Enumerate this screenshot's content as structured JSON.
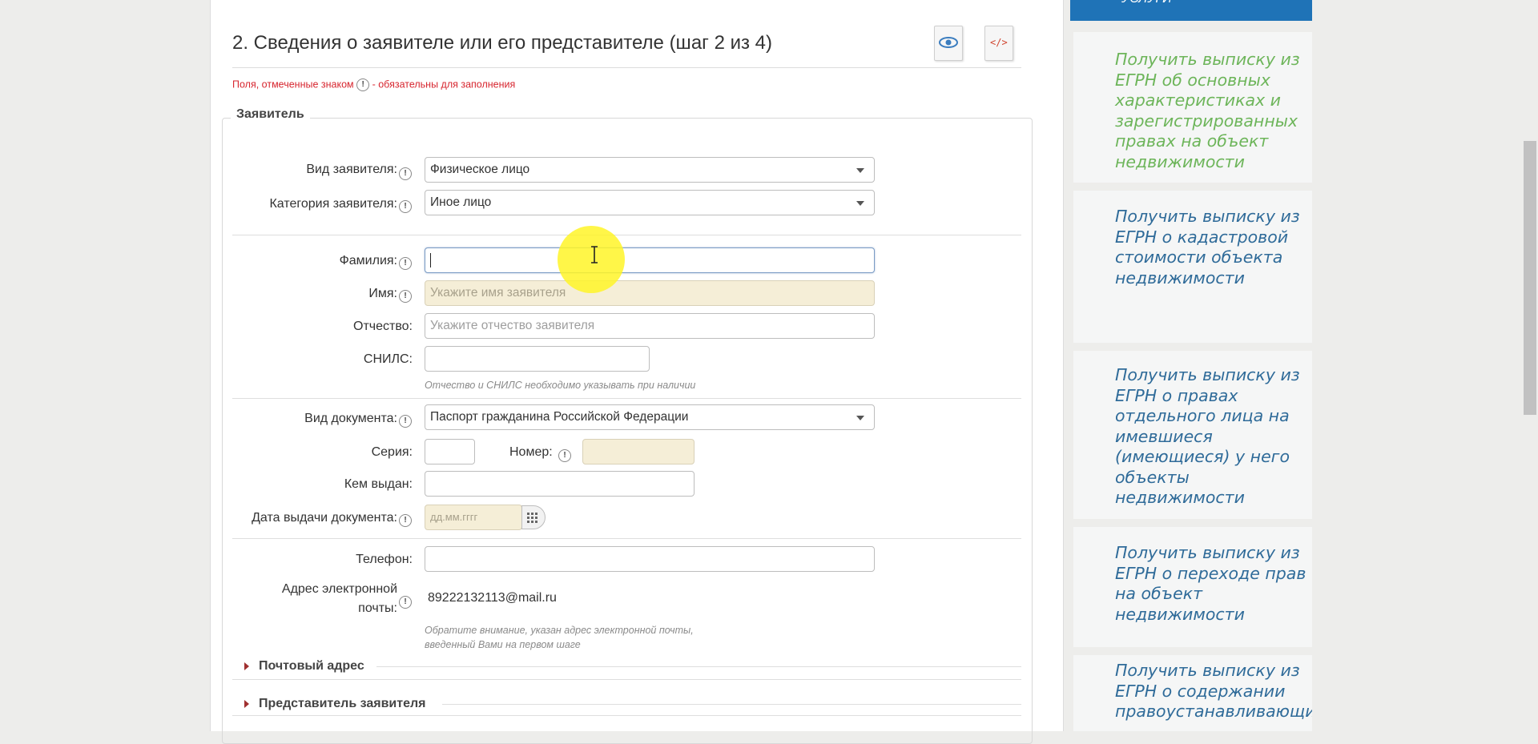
{
  "form": {
    "title": "2. Сведения о заявителе или его представителе (шаг 2 из 4)",
    "required_note_before": "Поля, отмеченные знаком",
    "required_note_after": "- обязательны для заполнения",
    "required_mark": "!",
    "fieldset_legend": "Заявитель",
    "applicant_type": {
      "label": "Вид заявителя:",
      "value": "Физическое лицо"
    },
    "applicant_category": {
      "label": "Категория заявителя:",
      "value": "Иное лицо"
    },
    "surname": {
      "label": "Фамилия:",
      "value": ""
    },
    "first_name": {
      "label": "Имя:",
      "placeholder": "Укажите имя заявителя"
    },
    "patronymic": {
      "label": "Отчество:",
      "placeholder": "Укажите отчество заявителя"
    },
    "snils": {
      "label": "СНИЛС:",
      "value": ""
    },
    "snils_hint": "Отчество и СНИЛС необходимо указывать при наличии",
    "doc_type": {
      "label": "Вид документа:",
      "value": "Паспорт гражданина Российской Федерации"
    },
    "series": {
      "label": "Серия:",
      "value": ""
    },
    "number": {
      "label": "Номер:",
      "value": ""
    },
    "issued_by": {
      "label": "Кем выдан:",
      "value": ""
    },
    "issue_date": {
      "label": "Дата выдачи документа:",
      "placeholder": "дд.мм.гггг"
    },
    "phone": {
      "label": "Телефон:",
      "value": ""
    },
    "email": {
      "label_line1": "Адрес электронной",
      "label_line2": "почты:",
      "value": "89222132113@mail.ru"
    },
    "email_hint_line1": "Обратите внимание, указан адрес электронной почты,",
    "email_hint_line2": "введенный Вами на первом шаге",
    "postal_section": "Почтовый адрес",
    "representative_section": "Представитель заявителя"
  },
  "sidebar": {
    "top_button": "УСЛУГИ",
    "links": [
      {
        "text": "Получить выписку из ЕГРН об основных характеристиках и зарегистрированных правах на объект недвижимости",
        "color": "#6db55a"
      },
      {
        "text": "Получить выписку из ЕГРН о кадастровой стоимости объекта недвижимости",
        "color": "#2f6b99"
      },
      {
        "text": "Получить выписку из ЕГРН о правах отдельного лица на имевшиеся (имеющиеся) у него объекты недвижимости",
        "color": "#2f6b99"
      },
      {
        "text": "Получить выписку из ЕГРН о переходе прав на объект недвижимости",
        "color": "#2f6b99"
      },
      {
        "text": "Получить выписку из ЕГРН о содержании правоустанавливающих",
        "color": "#2f6b99"
      }
    ]
  },
  "icons": {
    "preview": "eye-document-icon",
    "xml": "code-document-icon",
    "calendar": "calendar-icon",
    "cursor": "text-cursor-icon"
  }
}
